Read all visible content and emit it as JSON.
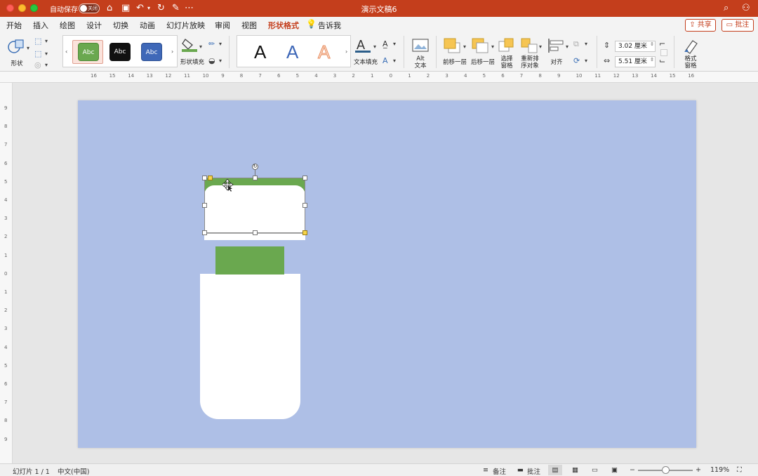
{
  "titlebar": {
    "autosave_label": "自动保存",
    "autosave_state": "关闭",
    "document_title": "演示文稿6"
  },
  "tabs": [
    {
      "label": "开始"
    },
    {
      "label": "插入"
    },
    {
      "label": "绘图"
    },
    {
      "label": "设计"
    },
    {
      "label": "切换"
    },
    {
      "label": "动画"
    },
    {
      "label": "幻灯片放映"
    },
    {
      "label": "审阅"
    },
    {
      "label": "视图"
    },
    {
      "label": "形状格式",
      "active": true
    },
    {
      "label": "告诉我"
    }
  ],
  "header_buttons": {
    "share": "共享",
    "comments": "批注"
  },
  "ribbon": {
    "shapes_label": "形状",
    "style_swatches": [
      {
        "label": "Abc",
        "color": "#6aa84f"
      },
      {
        "label": "Abc",
        "color": "#111111"
      },
      {
        "label": "Abc",
        "color": "#3f68b8"
      }
    ],
    "shape_fill_label": "形状填充",
    "wordart": [
      {
        "label": "A",
        "color": "#111111"
      },
      {
        "label": "A",
        "color": "#3f68b8"
      },
      {
        "label": "A",
        "color": "#f2a27c"
      }
    ],
    "text_fill_label": "文本填充",
    "alt_text_label": "Alt\n文本",
    "bring_forward_label": "前移一层",
    "send_backward_label": "后移一层",
    "selection_pane_label": "选择\n窗格",
    "reorder_label": "重新排\n序对象",
    "align_label": "对齐",
    "height_value": "3.02 厘米",
    "width_value": "5.51 厘米",
    "format_pane_label": "格式\n窗格"
  },
  "ruler": {
    "h_ticks": [
      "16",
      "15",
      "14",
      "13",
      "12",
      "11",
      "10",
      "9",
      "8",
      "7",
      "6",
      "5",
      "4",
      "3",
      "2",
      "1",
      "0",
      "1",
      "2",
      "3",
      "4",
      "5",
      "6",
      "7",
      "8",
      "9",
      "10",
      "11",
      "12",
      "13",
      "14",
      "15",
      "16"
    ],
    "v_ticks": [
      "9",
      "8",
      "7",
      "6",
      "5",
      "4",
      "3",
      "2",
      "1",
      "0",
      "1",
      "2",
      "3",
      "4",
      "5",
      "6",
      "7",
      "8",
      "9"
    ]
  },
  "slide": {
    "background": "#aebfe6",
    "green": "#6aa84f",
    "white": "#ffffff"
  },
  "statusbar": {
    "slide_count": "幻灯片 1 / 1",
    "language": "中文(中国)",
    "notes": "备注",
    "comments": "批注",
    "zoom": "119%"
  }
}
